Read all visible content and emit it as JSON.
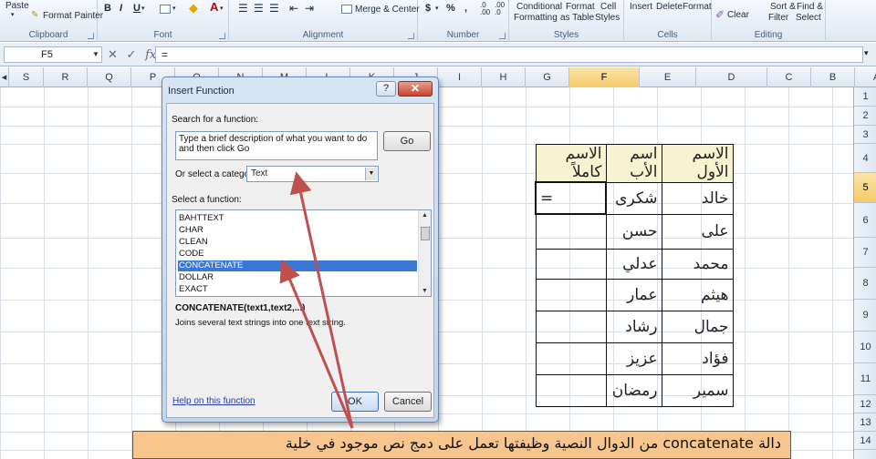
{
  "ribbon": {
    "clipboard": {
      "paste": "Paste",
      "format_painter": "Format Painter",
      "group": "Clipboard"
    },
    "font": {
      "bold": "B",
      "italic": "I",
      "underline": "U",
      "group": "Font"
    },
    "alignment": {
      "merge_center": "Merge & Center",
      "group": "Alignment"
    },
    "number": {
      "currency": "$",
      "percent": "%",
      "comma": ",",
      "inc_decimal": ".0 .00",
      "dec_decimal": ".00 .0",
      "group": "Number"
    },
    "styles": {
      "conditional_1": "Conditional",
      "conditional_2": "Formatting",
      "format_1": "Format",
      "format_2": "as Table",
      "cell_1": "Cell",
      "cell_2": "Styles",
      "group": "Styles"
    },
    "cells": {
      "insert": "Insert",
      "delete": "Delete",
      "format": "Format",
      "group": "Cells"
    },
    "editing": {
      "clear": "Clear",
      "sort_1": "Sort &",
      "sort_2": "Filter",
      "find_1": "Find &",
      "find_2": "Select",
      "group": "Editing"
    }
  },
  "formula_bar": {
    "name_box": "F5",
    "cancel": "✕",
    "enter": "✓",
    "fx": "fx",
    "content": "="
  },
  "columns": [
    "S",
    "R",
    "Q",
    "P",
    "O",
    "N",
    "M",
    "L",
    "K",
    "J",
    "I",
    "H",
    "G",
    "F",
    "E",
    "D",
    "C",
    "B",
    "A"
  ],
  "selected_column": "F",
  "rows": [
    "1",
    "2",
    "3",
    "4",
    "5",
    "6",
    "7",
    "8",
    "9",
    "10",
    "11",
    "12",
    "13",
    "14"
  ],
  "selected_row": "5",
  "table": {
    "headers": [
      "الاسم الأول",
      "اسم الأب",
      "الاسم كاملاً"
    ],
    "rows": [
      [
        "خالد",
        "شكرى",
        "="
      ],
      [
        "على",
        "حسن",
        ""
      ],
      [
        "محمد",
        "عدلي",
        ""
      ],
      [
        "هيثم",
        "عمار",
        ""
      ],
      [
        "جمال",
        "رشاد",
        ""
      ],
      [
        "فؤاد",
        "عزيز",
        ""
      ],
      [
        "سمير",
        "رمضان",
        ""
      ]
    ]
  },
  "dialog": {
    "title": "Insert Function",
    "help": "?",
    "close": "✕",
    "search_label": "Search for a function:",
    "search_value": "Type a brief description of what you want to do and then click Go",
    "go": "Go",
    "category_label": "Or select a category:",
    "category_value": "Text",
    "select_label": "Select a function:",
    "functions": [
      "BAHTTEXT",
      "CHAR",
      "CLEAN",
      "CODE",
      "CONCATENATE",
      "DOLLAR",
      "EXACT"
    ],
    "selected_function": "CONCATENATE",
    "syntax": "CONCATENATE(text1,text2,...)",
    "description": "Joins several text strings into one text string.",
    "help_link": "Help on this function",
    "ok": "OK",
    "cancel": "Cancel"
  },
  "caption": "دالة concatenate من الدوال النصية  وظيفتها تعمل على دمج نص موجود في خلية"
}
